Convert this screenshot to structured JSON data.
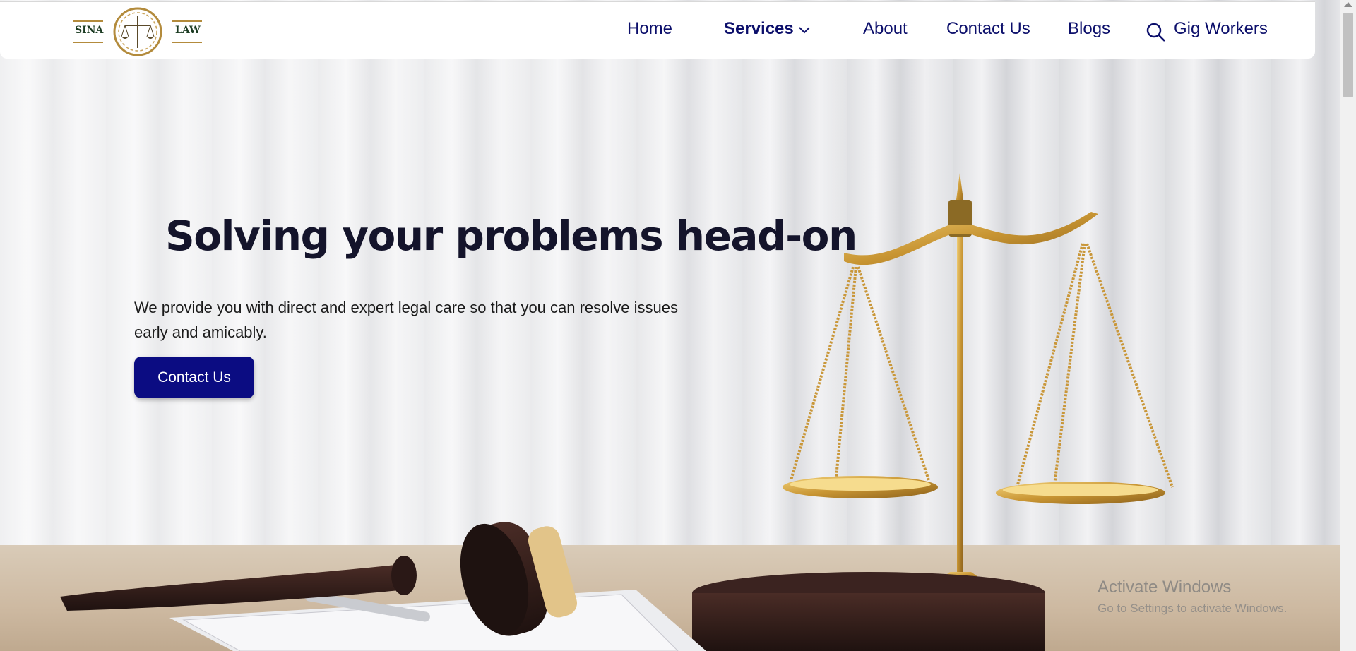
{
  "brand": {
    "left_word": "SINA",
    "right_word": "LAW",
    "accent": "#b38b3c"
  },
  "nav": {
    "items": [
      {
        "label": "Home"
      },
      {
        "label": "Services"
      },
      {
        "label": "About"
      },
      {
        "label": "Contact Us"
      },
      {
        "label": "Blogs"
      },
      {
        "label": "Gig Workers"
      }
    ],
    "icons": {
      "services_dropdown": "chevron-down-icon",
      "search": "search-icon"
    },
    "color": "#0c0f6b"
  },
  "hero": {
    "headline": "Solving your problems head-on",
    "subtext": "We provide you with direct and expert legal care so that you can resolve issues early and amicably.",
    "cta_label": "Contact Us",
    "cta_color": "#0b0c82"
  },
  "watermark": {
    "title": "Activate Windows",
    "subtitle": "Go to Settings to activate Windows."
  }
}
